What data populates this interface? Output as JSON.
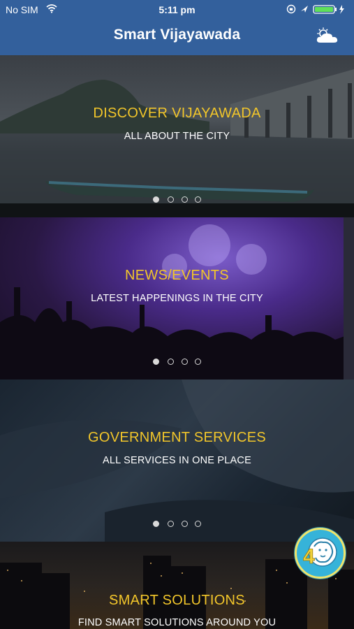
{
  "status_bar": {
    "carrier": "No SIM",
    "time": "5:11 pm"
  },
  "nav": {
    "title": "Smart Vijayawada",
    "weather_icon": "weather-cloud-sun-icon"
  },
  "panels": [
    {
      "title": "DISCOVER VIJAYAWADA",
      "subtitle": "ALL ABOUT THE CITY",
      "active_dot": 0,
      "dot_count": 4
    },
    {
      "title": "NEWS/EVENTS",
      "subtitle": "LATEST HAPPENINGS IN THE CITY",
      "active_dot": 0,
      "dot_count": 4
    },
    {
      "title": "GOVERNMENT SERVICES",
      "subtitle": "ALL SERVICES IN ONE PLACE",
      "active_dot": 0,
      "dot_count": 4
    },
    {
      "title": "SMART SOLUTIONS",
      "subtitle": "FIND SMART SOLUTIONS AROUND YOU"
    }
  ],
  "fab": {
    "icon": "lion-logo-icon",
    "label": "4"
  },
  "colors": {
    "nav_bg": "#33609c",
    "title_accent": "#f2c62a",
    "fab_bg": "#36b3d9"
  }
}
